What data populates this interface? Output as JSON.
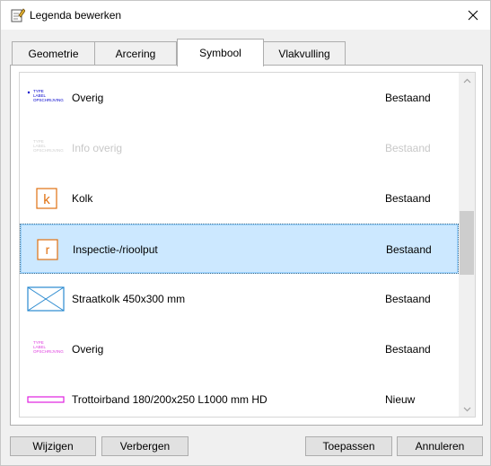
{
  "window": {
    "title": "Legenda bewerken"
  },
  "tabs": [
    {
      "label": "Geometrie",
      "active": false
    },
    {
      "label": "Arcering",
      "active": false
    },
    {
      "label": "Symbool",
      "active": true
    },
    {
      "label": "Vlakvulling",
      "active": false
    }
  ],
  "items": [
    {
      "name": "Overig",
      "status": "Bestaand",
      "symbol": "label-text-icon",
      "symbol_text": [
        "TYPE",
        "LABEL",
        "OPSCHRIJVING"
      ],
      "symbol_color": "#0000cc",
      "disabled": false,
      "selected": false
    },
    {
      "name": "Info overig",
      "status": "Bestaand",
      "symbol": "label-text-icon",
      "symbol_text": [
        "TYPE",
        "LABEL",
        "OPSCHRIJVING"
      ],
      "symbol_color": "#d0d0d0",
      "disabled": true,
      "selected": false
    },
    {
      "name": "Kolk",
      "status": "Bestaand",
      "symbol": "kolk-icon",
      "symbol_text": [
        "k"
      ],
      "symbol_color": "#e07010",
      "disabled": false,
      "selected": false
    },
    {
      "name": "Inspectie-/rioolput",
      "status": "Bestaand",
      "symbol": "rioolput-icon",
      "symbol_text": [
        "r"
      ],
      "symbol_color": "#e07010",
      "disabled": false,
      "selected": true
    },
    {
      "name": "Straatkolk 450x300 mm",
      "status": "Bestaand",
      "symbol": "straatkolk-icon",
      "symbol_text": [],
      "symbol_color": "#2a8ad0",
      "disabled": false,
      "selected": false
    },
    {
      "name": "Overig",
      "status": "Bestaand",
      "symbol": "label-text-icon",
      "symbol_text": [
        "TYPE",
        "LABEL",
        "OPSCHRIJVING"
      ],
      "symbol_color": "#e040e0",
      "disabled": false,
      "selected": false
    },
    {
      "name": "Trottoirband 180/200x250 L1000 mm HD",
      "status": "Nieuw",
      "symbol": "trottoirband-icon",
      "symbol_text": [],
      "symbol_color": "#e020e0",
      "disabled": false,
      "selected": false
    }
  ],
  "buttons": {
    "wijzigen": "Wijzigen",
    "verbergen": "Verbergen",
    "toepassen": "Toepassen",
    "annuleren": "Annuleren"
  }
}
